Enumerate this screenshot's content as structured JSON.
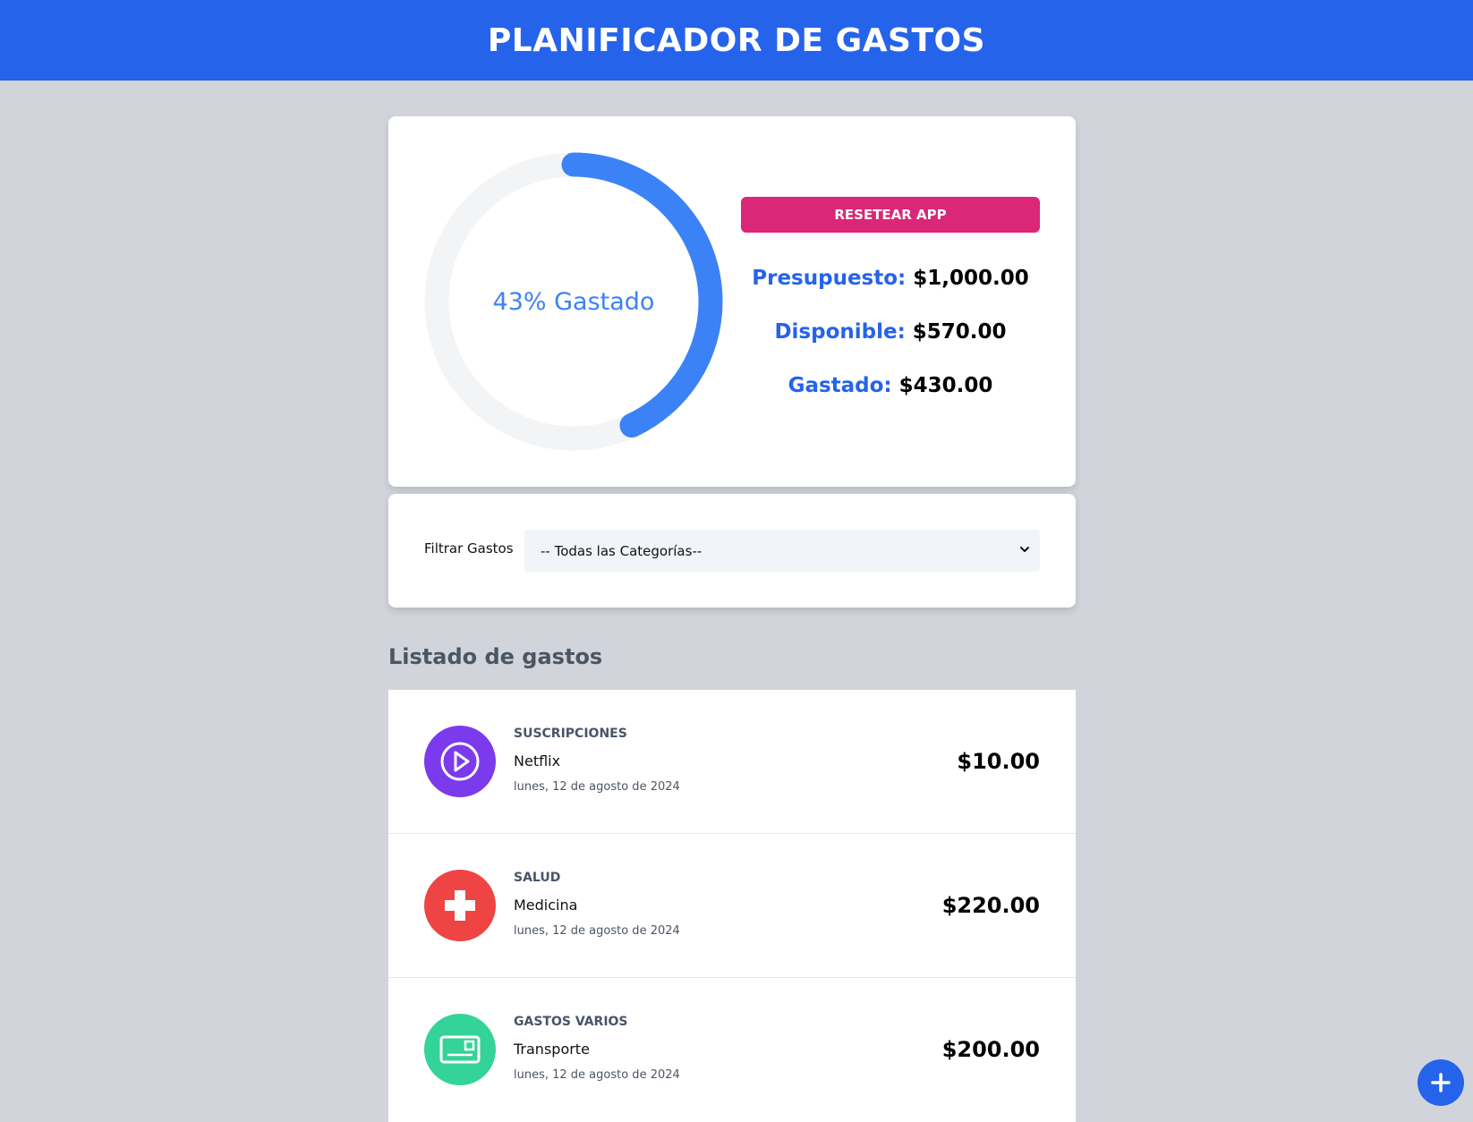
{
  "header": {
    "title": "PLANIFICADOR DE GASTOS"
  },
  "budget": {
    "percent_spent": 43,
    "ring_label": "43% Gastado",
    "reset_label": "RESETEAR APP",
    "presupuesto_label": "Presupuesto:",
    "presupuesto_value": "$1,000.00",
    "disponible_label": "Disponible:",
    "disponible_value": "$570.00",
    "gastado_label": "Gastado:",
    "gastado_value": "$430.00"
  },
  "filter": {
    "label": "Filtrar Gastos",
    "selected": "-- Todas las Categorías--"
  },
  "list": {
    "title": "Listado de gastos",
    "items": [
      {
        "category": "SUSCRIPCIONES",
        "name": "Netflix",
        "date": "lunes, 12 de agosto de 2024",
        "amount": "$10.00",
        "icon": "play-icon",
        "color": "#7c3aed"
      },
      {
        "category": "SALUD",
        "name": "Medicina",
        "date": "lunes, 12 de agosto de 2024",
        "amount": "$220.00",
        "icon": "health-cross-icon",
        "color": "#ef4444"
      },
      {
        "category": "GASTOS VARIOS",
        "name": "Transporte",
        "date": "lunes, 12 de agosto de 2024",
        "amount": "$200.00",
        "icon": "card-icon",
        "color": "#34d399"
      }
    ]
  },
  "colors": {
    "header": "#2563eb",
    "ring": "#3b82f6",
    "ring_track": "#f3f4f6",
    "reset": "#db2777"
  },
  "fab": {
    "icon": "plus-icon"
  }
}
